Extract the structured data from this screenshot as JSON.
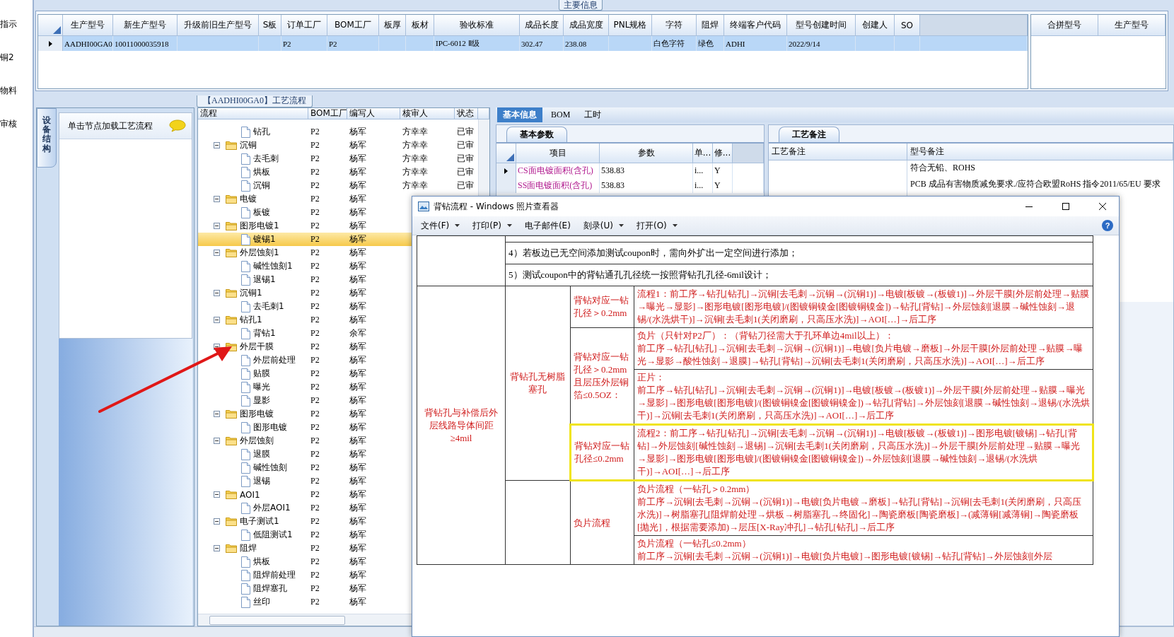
{
  "left_strip": {
    "items": [
      "指示",
      "铜2",
      "物料",
      "审核"
    ]
  },
  "main_info": {
    "title": "主要信息",
    "columns": [
      "生产型号",
      "新生产型号",
      "升级前旧生产型号",
      "S板",
      "订单工厂",
      "BOM工厂",
      "板厚",
      "板材",
      "验收标准",
      "成品长度",
      "成品宽度",
      "PNL规格",
      "字符",
      "阻焊",
      "终端客户代码",
      "型号创建时间",
      "创建人",
      "SO"
    ],
    "rows": [
      {
        "selected": true,
        "cells": [
          "AADHI00GA0",
          "10011000035918",
          null,
          null,
          "P2",
          "P2",
          null,
          null,
          "IPC-6012 Ⅱ级",
          "302.47",
          "238.08",
          null,
          "白色字符",
          "绿色",
          "ADHI",
          "2022/9/14",
          null,
          null
        ]
      }
    ]
  },
  "merge_grid": {
    "columns": [
      "合拼型号",
      "生产型号"
    ]
  },
  "side_panel": {
    "tab": "设备结构",
    "hint": "单击节点加载工艺流程"
  },
  "process_tree": {
    "title": "【AADHI00GA0】工艺流程",
    "columns": [
      "流程",
      "BOM工厂",
      "编写人",
      "核审人",
      "状态"
    ],
    "nodes": [
      {
        "kind": "continuation",
        "children": [
          {
            "kind": "step",
            "label": "钻孔",
            "bom": "P2",
            "writer": "杨军",
            "reviewer": "方幸幸",
            "status": "已审",
            "selected": false
          }
        ]
      },
      {
        "kind": "folder",
        "label": "沉铜",
        "bom": "P2",
        "writer": "杨军",
        "reviewer": "方幸幸",
        "status": "已审",
        "selected": false,
        "expanded": true,
        "children": [
          {
            "kind": "step",
            "label": "去毛刺",
            "bom": "P2",
            "writer": "杨军",
            "reviewer": "方幸幸",
            "status": "已审",
            "selected": false
          },
          {
            "kind": "step",
            "label": "烘板",
            "bom": "P2",
            "writer": "杨军",
            "reviewer": "方幸幸",
            "status": "已审",
            "selected": false
          },
          {
            "kind": "step",
            "label": "沉铜",
            "bom": "P2",
            "writer": "杨军",
            "reviewer": "方幸幸",
            "status": "已审",
            "selected": false
          }
        ]
      },
      {
        "kind": "folder",
        "label": "电镀",
        "bom": "P2",
        "writer": "杨军",
        "selected": false,
        "expanded": true,
        "children": [
          {
            "kind": "step",
            "label": "板镀",
            "bom": "P2",
            "writer": "杨军",
            "selected": false
          }
        ]
      },
      {
        "kind": "folder",
        "label": "图形电镀1",
        "bom": "P2",
        "writer": "杨军",
        "selected": false,
        "expanded": true,
        "children": [
          {
            "kind": "step",
            "label": "镀锡1",
            "bom": "P2",
            "writer": "杨军",
            "selected": true
          }
        ]
      },
      {
        "kind": "folder",
        "label": "外层蚀刻1",
        "bom": "P2",
        "writer": "杨军",
        "selected": false,
        "expanded": true,
        "children": [
          {
            "kind": "step",
            "label": "碱性蚀刻1",
            "bom": "P2",
            "writer": "杨军",
            "selected": false
          },
          {
            "kind": "step",
            "label": "退锡1",
            "bom": "P2",
            "writer": "杨军",
            "selected": false
          }
        ]
      },
      {
        "kind": "folder",
        "label": "沉铜1",
        "bom": "P2",
        "writer": "杨军",
        "selected": false,
        "expanded": true,
        "children": [
          {
            "kind": "step",
            "label": "去毛刺1",
            "bom": "P2",
            "writer": "杨军",
            "selected": false
          }
        ]
      },
      {
        "kind": "folder",
        "label": "钻孔1",
        "bom": "P2",
        "writer": "杨军",
        "selected": false,
        "expanded": true,
        "children": [
          {
            "kind": "step",
            "label": "背钻1",
            "bom": "P2",
            "writer": "余军",
            "selected": false
          }
        ]
      },
      {
        "kind": "folder",
        "label": "外层干膜",
        "bom": "P2",
        "writer": "杨军",
        "selected": false,
        "expanded": true,
        "children": [
          {
            "kind": "step",
            "label": "外层前处理",
            "bom": "P2",
            "writer": "杨军",
            "selected": false
          },
          {
            "kind": "step",
            "label": "贴膜",
            "bom": "P2",
            "writer": "杨军",
            "selected": false
          },
          {
            "kind": "step",
            "label": "曝光",
            "bom": "P2",
            "writer": "杨军",
            "selected": false
          },
          {
            "kind": "step",
            "label": "显影",
            "bom": "P2",
            "writer": "杨军",
            "selected": false
          }
        ]
      },
      {
        "kind": "folder",
        "label": "图形电镀",
        "bom": "P2",
        "writer": "杨军",
        "selected": false,
        "expanded": true,
        "children": [
          {
            "kind": "step",
            "label": "图形电镀",
            "bom": "P2",
            "writer": "杨军",
            "selected": false
          }
        ]
      },
      {
        "kind": "folder",
        "label": "外层蚀刻",
        "bom": "P2",
        "writer": "杨军",
        "selected": false,
        "expanded": true,
        "children": [
          {
            "kind": "step",
            "label": "退膜",
            "bom": "P2",
            "writer": "杨军",
            "selected": false
          },
          {
            "kind": "step",
            "label": "碱性蚀刻",
            "bom": "P2",
            "writer": "杨军",
            "selected": false
          },
          {
            "kind": "step",
            "label": "退锡",
            "bom": "P2",
            "writer": "杨军",
            "selected": false
          }
        ]
      },
      {
        "kind": "folder",
        "label": "AOI1",
        "bom": "P2",
        "writer": "杨军",
        "selected": false,
        "expanded": true,
        "children": [
          {
            "kind": "step",
            "label": "外层AOI1",
            "bom": "P2",
            "writer": "杨军",
            "selected": false
          }
        ]
      },
      {
        "kind": "folder",
        "label": "电子测试1",
        "bom": "P2",
        "writer": "杨军",
        "selected": false,
        "expanded": true,
        "children": [
          {
            "kind": "step",
            "label": "低阻测试1",
            "bom": "P2",
            "writer": "杨军",
            "selected": false
          }
        ]
      },
      {
        "kind": "folder",
        "label": "阻焊",
        "bom": "P2",
        "writer": "杨军",
        "selected": false,
        "expanded": true,
        "children": [
          {
            "kind": "step",
            "label": "烘板",
            "bom": "P2",
            "writer": "杨军",
            "selected": false
          },
          {
            "kind": "step",
            "label": "阻焊前处理",
            "bom": "P2",
            "writer": "杨军",
            "selected": false
          },
          {
            "kind": "step",
            "label": "阻焊塞孔",
            "bom": "P2",
            "writer": "杨军",
            "selected": false
          },
          {
            "kind": "step",
            "label": "丝印",
            "bom": "P2",
            "writer": "杨军",
            "selected": false
          }
        ]
      }
    ]
  },
  "detail_tabs": [
    {
      "label": "基本信息",
      "selected": true
    },
    {
      "label": "BOM",
      "selected": false
    },
    {
      "label": "工时",
      "selected": false
    }
  ],
  "basic_params": {
    "tab": "基本参数",
    "columns": [
      "项目",
      "参数",
      "单...",
      "修..."
    ],
    "rows": [
      {
        "selected": true,
        "cells": [
          "CS面电镀面积(含孔)",
          "538.83",
          "i...",
          "Y"
        ]
      },
      {
        "selected": false,
        "cells": [
          "SS面电镀面积(含孔)",
          "538.83",
          "i...",
          "Y"
        ]
      }
    ]
  },
  "remarks": {
    "tab": "工艺备注",
    "columns": [
      "工艺备注",
      "型号备注"
    ],
    "model_remarks": [
      "符合无铅、ROHS",
      "PCB 成品有害物质减免要求./应符合欧盟RoHS 指令2011/65/EU 要求"
    ]
  },
  "photo_viewer": {
    "title": "背钻流程 - Windows 照片查看器",
    "menu": [
      {
        "label": "文件(F)",
        "dropdown": true
      },
      {
        "label": "打印(P)",
        "dropdown": true
      },
      {
        "label": "电子邮件(E)",
        "dropdown": false
      },
      {
        "label": "刻录(U)",
        "dropdown": true
      },
      {
        "label": "打开(O)",
        "dropdown": true
      }
    ],
    "help": "?",
    "document": {
      "notes": [
        "4）若板边已无空间添加测试coupon时，需向外扩出一定空间进行添加；",
        "5）测试coupon中的背钻通孔孔径统一按照背钻孔孔径-6mil设计；"
      ],
      "section_label": "背钻孔与补偿后外层线路导体间距≥4mil",
      "groups": [
        {
          "label": "背钻孔无树脂塞孔",
          "conditions": [
            {
              "label": "背钻对应一钻孔径＞0.2mm",
              "highlighted": false,
              "flows": [
                {
                  "lines": [
                    "流程1：前工序→钻孔[钻孔]→沉铜[去毛刺→沉铜→(沉铜1)]→电镀[板镀→(板镀1)]→外层干膜[外层前处理→贴膜→曝光→显影]→图形电镀[图形电镀]/(图镀铜镍金[图镀铜镍金])→钻孔[背钻]→外层蚀刻[退膜→碱性蚀刻→退锡/(水洗烘干)]→沉铜[去毛刺1(关闭磨刷，只高压水洗)]→AOI[…]→后工序"
                  ]
                }
              ]
            },
            {
              "label": "背钻对应一钻孔径＞0.2mm且层压外层铜箔≤0.5OZ：",
              "highlighted": false,
              "flows": [
                {
                  "lines": [
                    "负片（只针对P2厂）：（背钻刀径需大于孔环单边4mil以上）：",
                    "前工序→钻孔[钻孔]→沉铜[去毛刺→沉铜→(沉铜1)]→电镀[负片电镀→磨板]→外层干膜[外层前处理→贴膜→曝光→显影→酸性蚀刻→退膜]→钻孔[背钻]→沉铜[去毛刺1(关闭磨刷，只高压水洗)]→AOI[…]→后工序"
                  ]
                },
                {
                  "lines": [
                    "正片：",
                    "前工序→钻孔[钻孔]→沉铜[去毛刺→沉铜→(沉铜1)]→电镀[板镀→(板镀1)]→外层干膜[外层前处理→贴膜→曝光→显影]→图形电镀[图形电镀]/(图镀铜镍金[图镀铜镍金])→钻孔[背钻]→外层蚀刻[退膜→碱性蚀刻→退锡/(水洗烘干)]→沉铜[去毛刺1(关闭磨刷，只高压水洗)]→AOI[…]→后工序"
                  ]
                }
              ]
            },
            {
              "label": "背钻对应一钻孔径≤0.2mm",
              "highlighted": true,
              "flows": [
                {
                  "lines": [
                    "流程2：前工序→钻孔[钻孔]→沉铜[去毛刺→沉铜→(沉铜1)]→电镀[板镀→(板镀1)]→图形电镀[镀锡]→钻孔[背钻]→外层蚀刻[碱性蚀刻→退锡]→沉铜[去毛刺1(关闭磨刷，只高压水洗)]→外层干膜[外层前处理→贴膜→曝光→显影]→图形电镀[图形电镀]/(图镀铜镍金[图镀铜镍金])→外层蚀刻[退膜→碱性蚀刻→退锡/(水洗烘干)]→AOI[…]→后工序"
                  ]
                }
              ]
            }
          ]
        },
        {
          "conditions": [
            {
              "label": "负片流程",
              "highlighted": false,
              "flows": [
                {
                  "lines": [
                    "负片流程（一钻孔＞0.2mm）",
                    "前工序→沉铜[去毛刺→沉铜→(沉铜1)]→电镀[负片电镀→磨板]→钻孔[背钻]→沉铜[去毛刺1(关闭磨刷，只高压水洗)]→树脂塞孔[阻焊前处理→烘板→树脂塞孔→终固化]→陶瓷磨板[陶瓷磨板]→(减薄铜[减薄铜]→陶瓷磨板[抛光]，根据需要添加)→层压[X-Ray冲孔]→钻孔[钻孔]→后工序"
                  ]
                },
                {
                  "lines": [
                    "负片流程（一钻孔≤0.2mm）",
                    "前工序→沉铜[去毛刺→沉铜→(沉铜1)]→电镀[负片电镀]→图形电镀[镀锡]→钻孔[背钻]→外层蚀刻[外层"
                  ]
                }
              ]
            }
          ]
        }
      ]
    }
  }
}
